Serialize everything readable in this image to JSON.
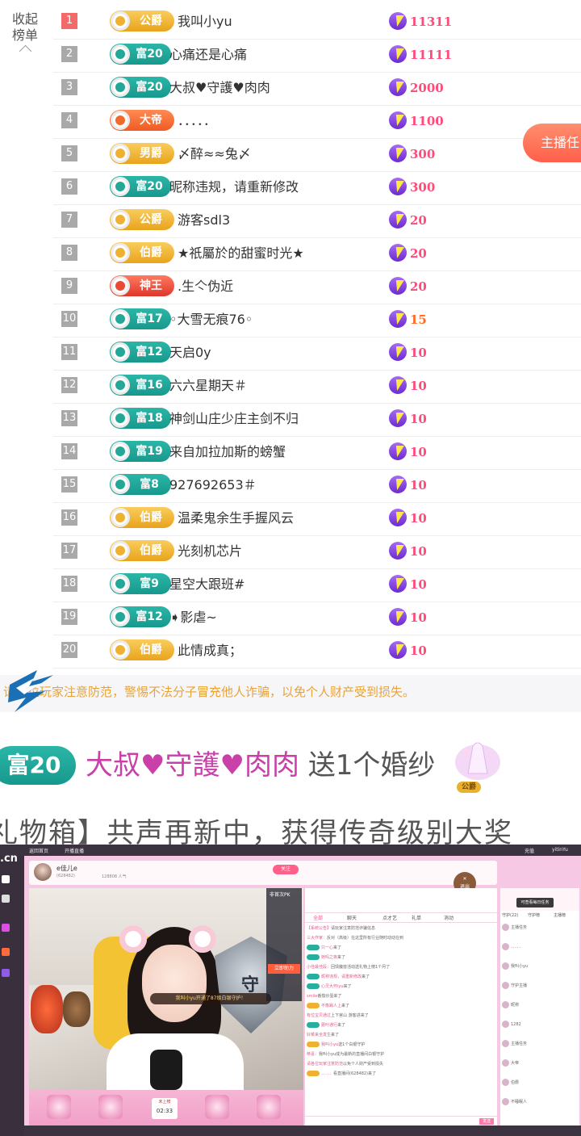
{
  "rank_panel": {
    "collapse_label_1": "收起",
    "collapse_label_2": "榜单",
    "anchor_task_button": "主播任",
    "rows": [
      {
        "rank": "1",
        "badge": "公爵",
        "badge_type": "jue",
        "name": "我叫小yu",
        "score": "11311"
      },
      {
        "rank": "2",
        "badge": "富20",
        "badge_type": "fu",
        "name": "心痛还是心痛",
        "score": "11111"
      },
      {
        "rank": "3",
        "badge": "富20",
        "badge_type": "fu",
        "name": "大叔♥守護♥肉肉",
        "score": "2000"
      },
      {
        "rank": "4",
        "badge": "大帝",
        "badge_type": "dadi",
        "name": "．．．．．",
        "score": "1100"
      },
      {
        "rank": "5",
        "badge": "男爵",
        "badge_type": "jue",
        "name": "〆醉≈≈兔〆",
        "score": "300"
      },
      {
        "rank": "6",
        "badge": "富20",
        "badge_type": "fu",
        "name": "昵称违规，请重新修改",
        "score": "300"
      },
      {
        "rank": "7",
        "badge": "公爵",
        "badge_type": "jue",
        "name": "游客sdl3",
        "score": "20"
      },
      {
        "rank": "8",
        "badge": "伯爵",
        "badge_type": "jue",
        "name": "★祇屬於的甜蜜时光★",
        "score": "20"
      },
      {
        "rank": "9",
        "badge": "神王",
        "badge_type": "shenwang",
        "name": ".生亽伪近",
        "score": "20"
      },
      {
        "rank": "10",
        "badge": "富17",
        "badge_type": "fu",
        "name": "◦大雪无痕76◦",
        "score": "15"
      },
      {
        "rank": "11",
        "badge": "富12",
        "badge_type": "fu",
        "name": "天启0y",
        "score": "10"
      },
      {
        "rank": "12",
        "badge": "富16",
        "badge_type": "fu",
        "name": "六六星期天＃",
        "score": "10"
      },
      {
        "rank": "13",
        "badge": "富18",
        "badge_type": "fu",
        "name": "神剑山庄少庄主剑不归",
        "score": "10"
      },
      {
        "rank": "14",
        "badge": "富19",
        "badge_type": "fu",
        "name": "来自加拉加斯的螃蟹",
        "score": "10"
      },
      {
        "rank": "15",
        "badge": "富8",
        "badge_type": "fu",
        "name": "927692653＃",
        "score": "10"
      },
      {
        "rank": "16",
        "badge": "伯爵",
        "badge_type": "jue",
        "name": "温柔鬼余生手握风云",
        "score": "10"
      },
      {
        "rank": "17",
        "badge": "伯爵",
        "badge_type": "jue",
        "name": "光刻机芯片",
        "score": "10"
      },
      {
        "rank": "18",
        "badge": "富9",
        "badge_type": "fu",
        "name": "星空大跟班#",
        "score": "10"
      },
      {
        "rank": "19",
        "badge": "富12",
        "badge_type": "fu",
        "name": "➧影虐~",
        "score": "10"
      },
      {
        "rank": "20",
        "badge": "伯爵",
        "badge_type": "jue",
        "name": "此情成真；",
        "score": "10"
      }
    ]
  },
  "notice": {
    "text": "请各位玩家注意防范，警惕不法分子冒充他人诈骗，以免个人财产受到损失。"
  },
  "gift": {
    "badge": "富20",
    "user": "大叔♥守護♥肉肉",
    "action": "送1个婚纱",
    "nobility": "公爵",
    "scroll_text": "礼物箱】共声再新中，获得传奇级别大奖"
  },
  "room": {
    "logo": ".cn",
    "topbar": {
      "home": "返回首页",
      "open_stream": "开播直播",
      "recharge": "充值",
      "user": "yitinYu"
    },
    "anchor": {
      "name": "e佳儿e",
      "id": "(628482)",
      "fans": "128808 人气",
      "follow": "关注"
    },
    "guard_toast": "我叫小yu开通了87级白银守护！",
    "pk_title": "非首次PK",
    "pk_button": "立即助力",
    "timer_top": "未上榜",
    "timer_value": "02:33",
    "chat_tabs": [
      "全部",
      "聊天",
      "点才艺",
      "礼单",
      "消动"
    ],
    "chat_lines": [
      {
        "lv": "",
        "name": "【系统公告】",
        "text": "请玩家注意防范诈骗信息"
      },
      {
        "lv": "",
        "name": "三大作家：",
        "text": "反对（高级）在这里所有行业随时动动在到"
      },
      {
        "lv": "富18",
        "name": "只一心",
        "text": "来了"
      },
      {
        "lv": "富17",
        "name": "她吗之夜",
        "text": "来了"
      },
      {
        "lv": "",
        "name": "小佳最佳段：",
        "text": "回馈魔兽活动送礼物上榜1个月了"
      },
      {
        "lv": "富18",
        "name": "昵称违规，请重新修改",
        "text": "来了"
      },
      {
        "lv": "富16",
        "name": "心灵大怀iyu",
        "text": "来了"
      },
      {
        "lv": "",
        "name": "smile",
        "text": "番茄炒蛋来了"
      },
      {
        "lv": "伯爵",
        "name": "不像踢人上",
        "text": "来了"
      },
      {
        "lv": "",
        "name": "有位宝贝通过",
        "text": "上下宫山 游客进来了"
      },
      {
        "lv": "富18",
        "name": "蘑叶通行",
        "text": "来了"
      },
      {
        "lv": "",
        "name": "好菜来全发生",
        "text": "来了"
      },
      {
        "lv": "伯爵",
        "name": "我叫小yu",
        "text": "送1个白银守护"
      },
      {
        "lv": "",
        "name": "恭喜：",
        "text": "我叫小yu成为最新的直播间白银守护"
      },
      {
        "lv": "",
        "name": "请各位玩家注意防范",
        "text": "以免个人财产受到损失"
      },
      {
        "lv": "大帝",
        "name": "．．．．．",
        "text": "看直播间(628482)来了"
      }
    ],
    "send": "发送",
    "right_tabs": [
      "守护(22)",
      "守护榜",
      "主播榜"
    ],
    "task_popup": "可查看每日任务",
    "right_rows": [
      "主播任务",
      "．．．．．",
      "我叫小yu",
      "守护主播",
      "昵称",
      "1282",
      "主播任务",
      "大帝",
      "伯爵",
      "不睡眠人"
    ],
    "close_label": "退出"
  },
  "colors": {
    "score_pink": "#ff4a7a",
    "badge_fu": "#1ea999",
    "badge_jue": "#eeb132",
    "notice_orange": "#e7a33a",
    "gift_name": "#c840a8"
  },
  "icons": {
    "bolt": "lightning-bolt-icon",
    "collapse": "chevron-up-icon",
    "bird": "bird-logo-icon"
  }
}
